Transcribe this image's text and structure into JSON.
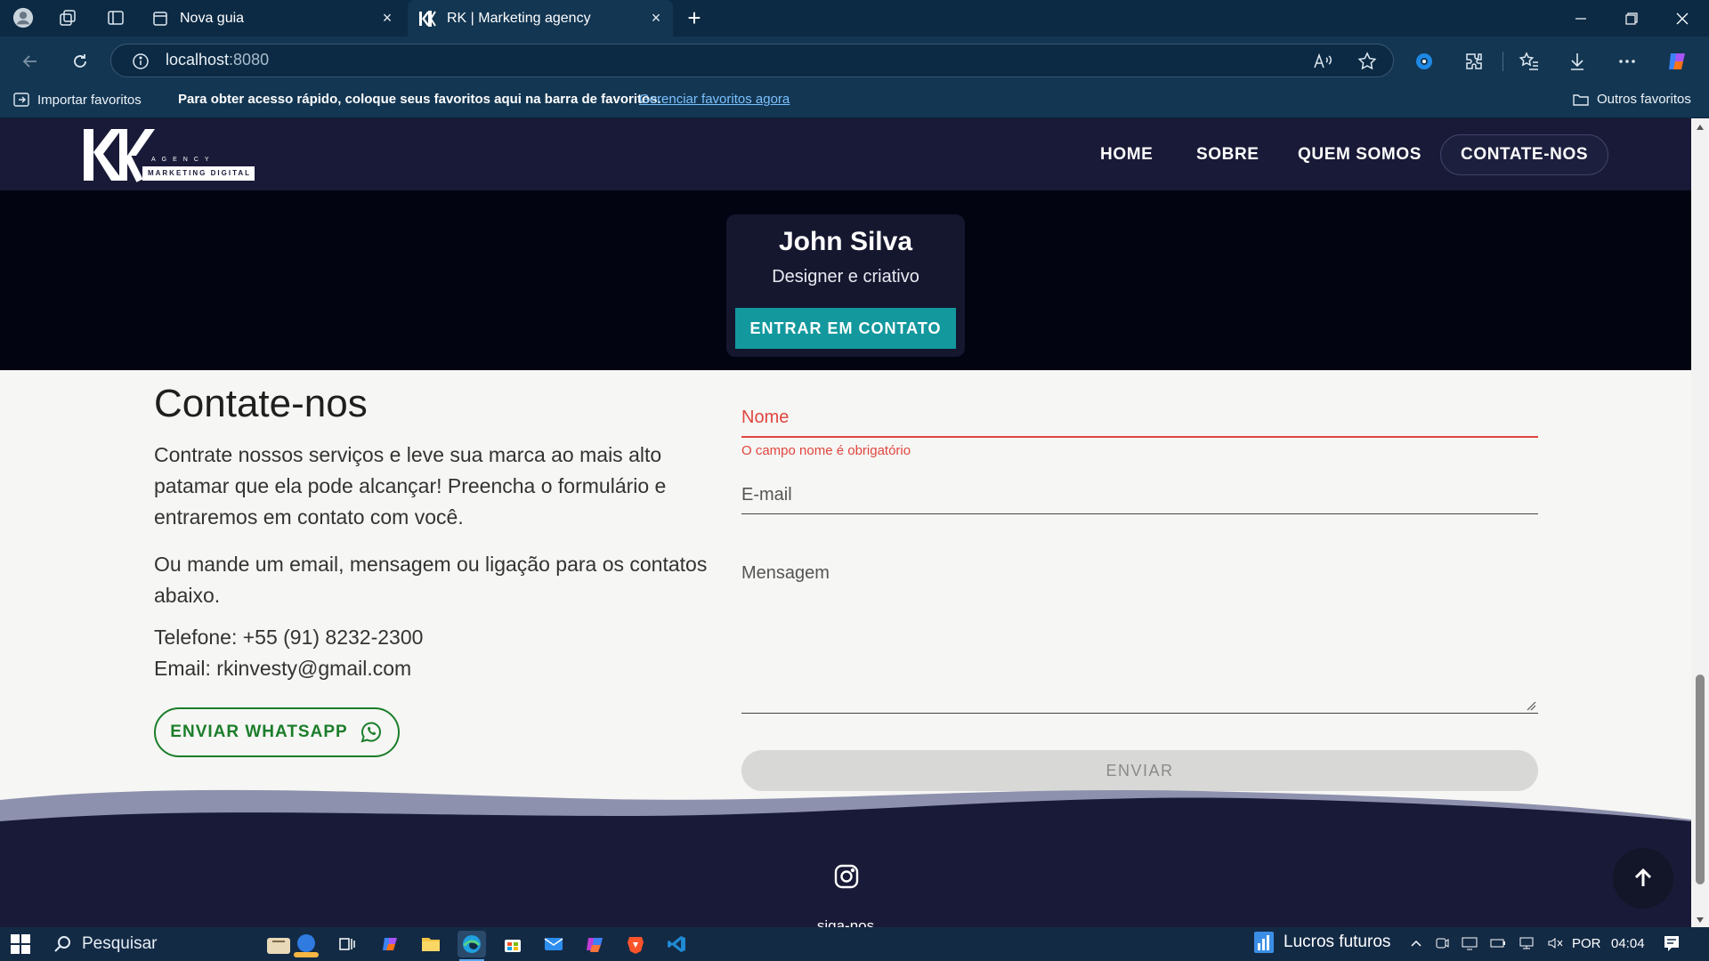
{
  "browser": {
    "tabs": [
      {
        "label": "Nova guia",
        "close": "×"
      },
      {
        "label": "RK | Marketing agency",
        "close": "×"
      }
    ],
    "new_tab": "+",
    "url_host": "localhost",
    "url_port": ":8080",
    "favorites_bar": {
      "import": "Importar favoritos",
      "message": "Para obter acesso rápido, coloque seus favoritos aqui na barra de favoritos.",
      "manage_link": "Gerenciar favoritos agora",
      "other": "Outros favoritos"
    }
  },
  "site": {
    "logo": {
      "letters": "RK",
      "small_text": "AGENCY",
      "tagline": "MARKETING DIGITAL"
    },
    "nav": [
      "HOME",
      "SOBRE",
      "QUEM SOMOS",
      "CONTATE-NOS"
    ],
    "card": {
      "name": "John Silva",
      "role": "Designer e criativo",
      "button": "ENTRAR EM CONTATO"
    },
    "contact": {
      "title": "Contate-nos",
      "p1": "Contrate nossos serviços e leve sua marca ao mais alto patamar que ela pode alcançar! Preencha o formulário e entraremos em contato com você.",
      "p2": "Ou mande um email, mensagem ou ligação para os contatos abaixo.",
      "phone": "Telefone: +55 (91) 8232-2300",
      "email": "Email: rkinvesty@gmail.com",
      "whatsapp": "ENVIAR WHATSAPP"
    },
    "form": {
      "name_label": "Nome",
      "name_error": "O campo nome é obrigatório",
      "email_label": "E-mail",
      "message_label": "Mensagem",
      "send": "ENVIAR"
    },
    "footer": {
      "follow": "siga-nos"
    }
  },
  "taskbar": {
    "search": "Pesquisar",
    "weather": "Lucros futuros",
    "lang": "POR",
    "time": "04:04"
  },
  "colors": {
    "navbar": "#191a37",
    "accent_teal": "#13989d",
    "error_red": "#e0463f",
    "whatsapp_green": "#1b7d2a",
    "chrome_dark": "#0c2a44"
  }
}
